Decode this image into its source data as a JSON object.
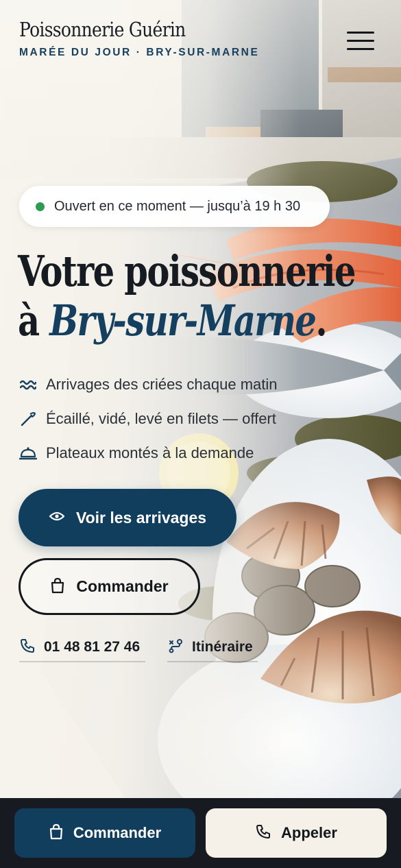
{
  "brand": {
    "name": "Poissonnerie Guérin",
    "tagline": "MARÉE DU JOUR · BRY-SUR-MARNE"
  },
  "header": {
    "menu_icon": "hamburger-menu-icon"
  },
  "status": {
    "text": "Ouvert en ce moment — jusqu’à 19 h 30",
    "dot_color": "#2f9a52"
  },
  "hero": {
    "title_line1": "Votre poissonnerie",
    "title_line2_prefix": "à ",
    "title_line2_accent": "Bry-sur-Marne",
    "title_line2_suffix": "."
  },
  "features": [
    {
      "icon": "waves-icon",
      "label": "Arrivages des criées chaque matin"
    },
    {
      "icon": "knife-icon",
      "label": "Écaillé, vidé, levé en filets — offert"
    },
    {
      "icon": "cloche-icon",
      "label": "Plateaux montés à la demande"
    }
  ],
  "cta": {
    "primary_label": "Voir les arrivages",
    "primary_icon": "eye-icon",
    "secondary_label": "Commander",
    "secondary_icon": "shopping-bag-icon"
  },
  "contact": {
    "phone": "01 48 81 27 46",
    "phone_icon": "phone-icon",
    "route_label": "Itinéraire",
    "route_icon": "route-icon"
  },
  "bottom_bar": {
    "order_label": "Commander",
    "call_label": "Appeler"
  },
  "colors": {
    "brand_navy": "#123e5e",
    "ink": "#161b21",
    "cream": "#f5f1e8",
    "bar": "#171b21"
  }
}
